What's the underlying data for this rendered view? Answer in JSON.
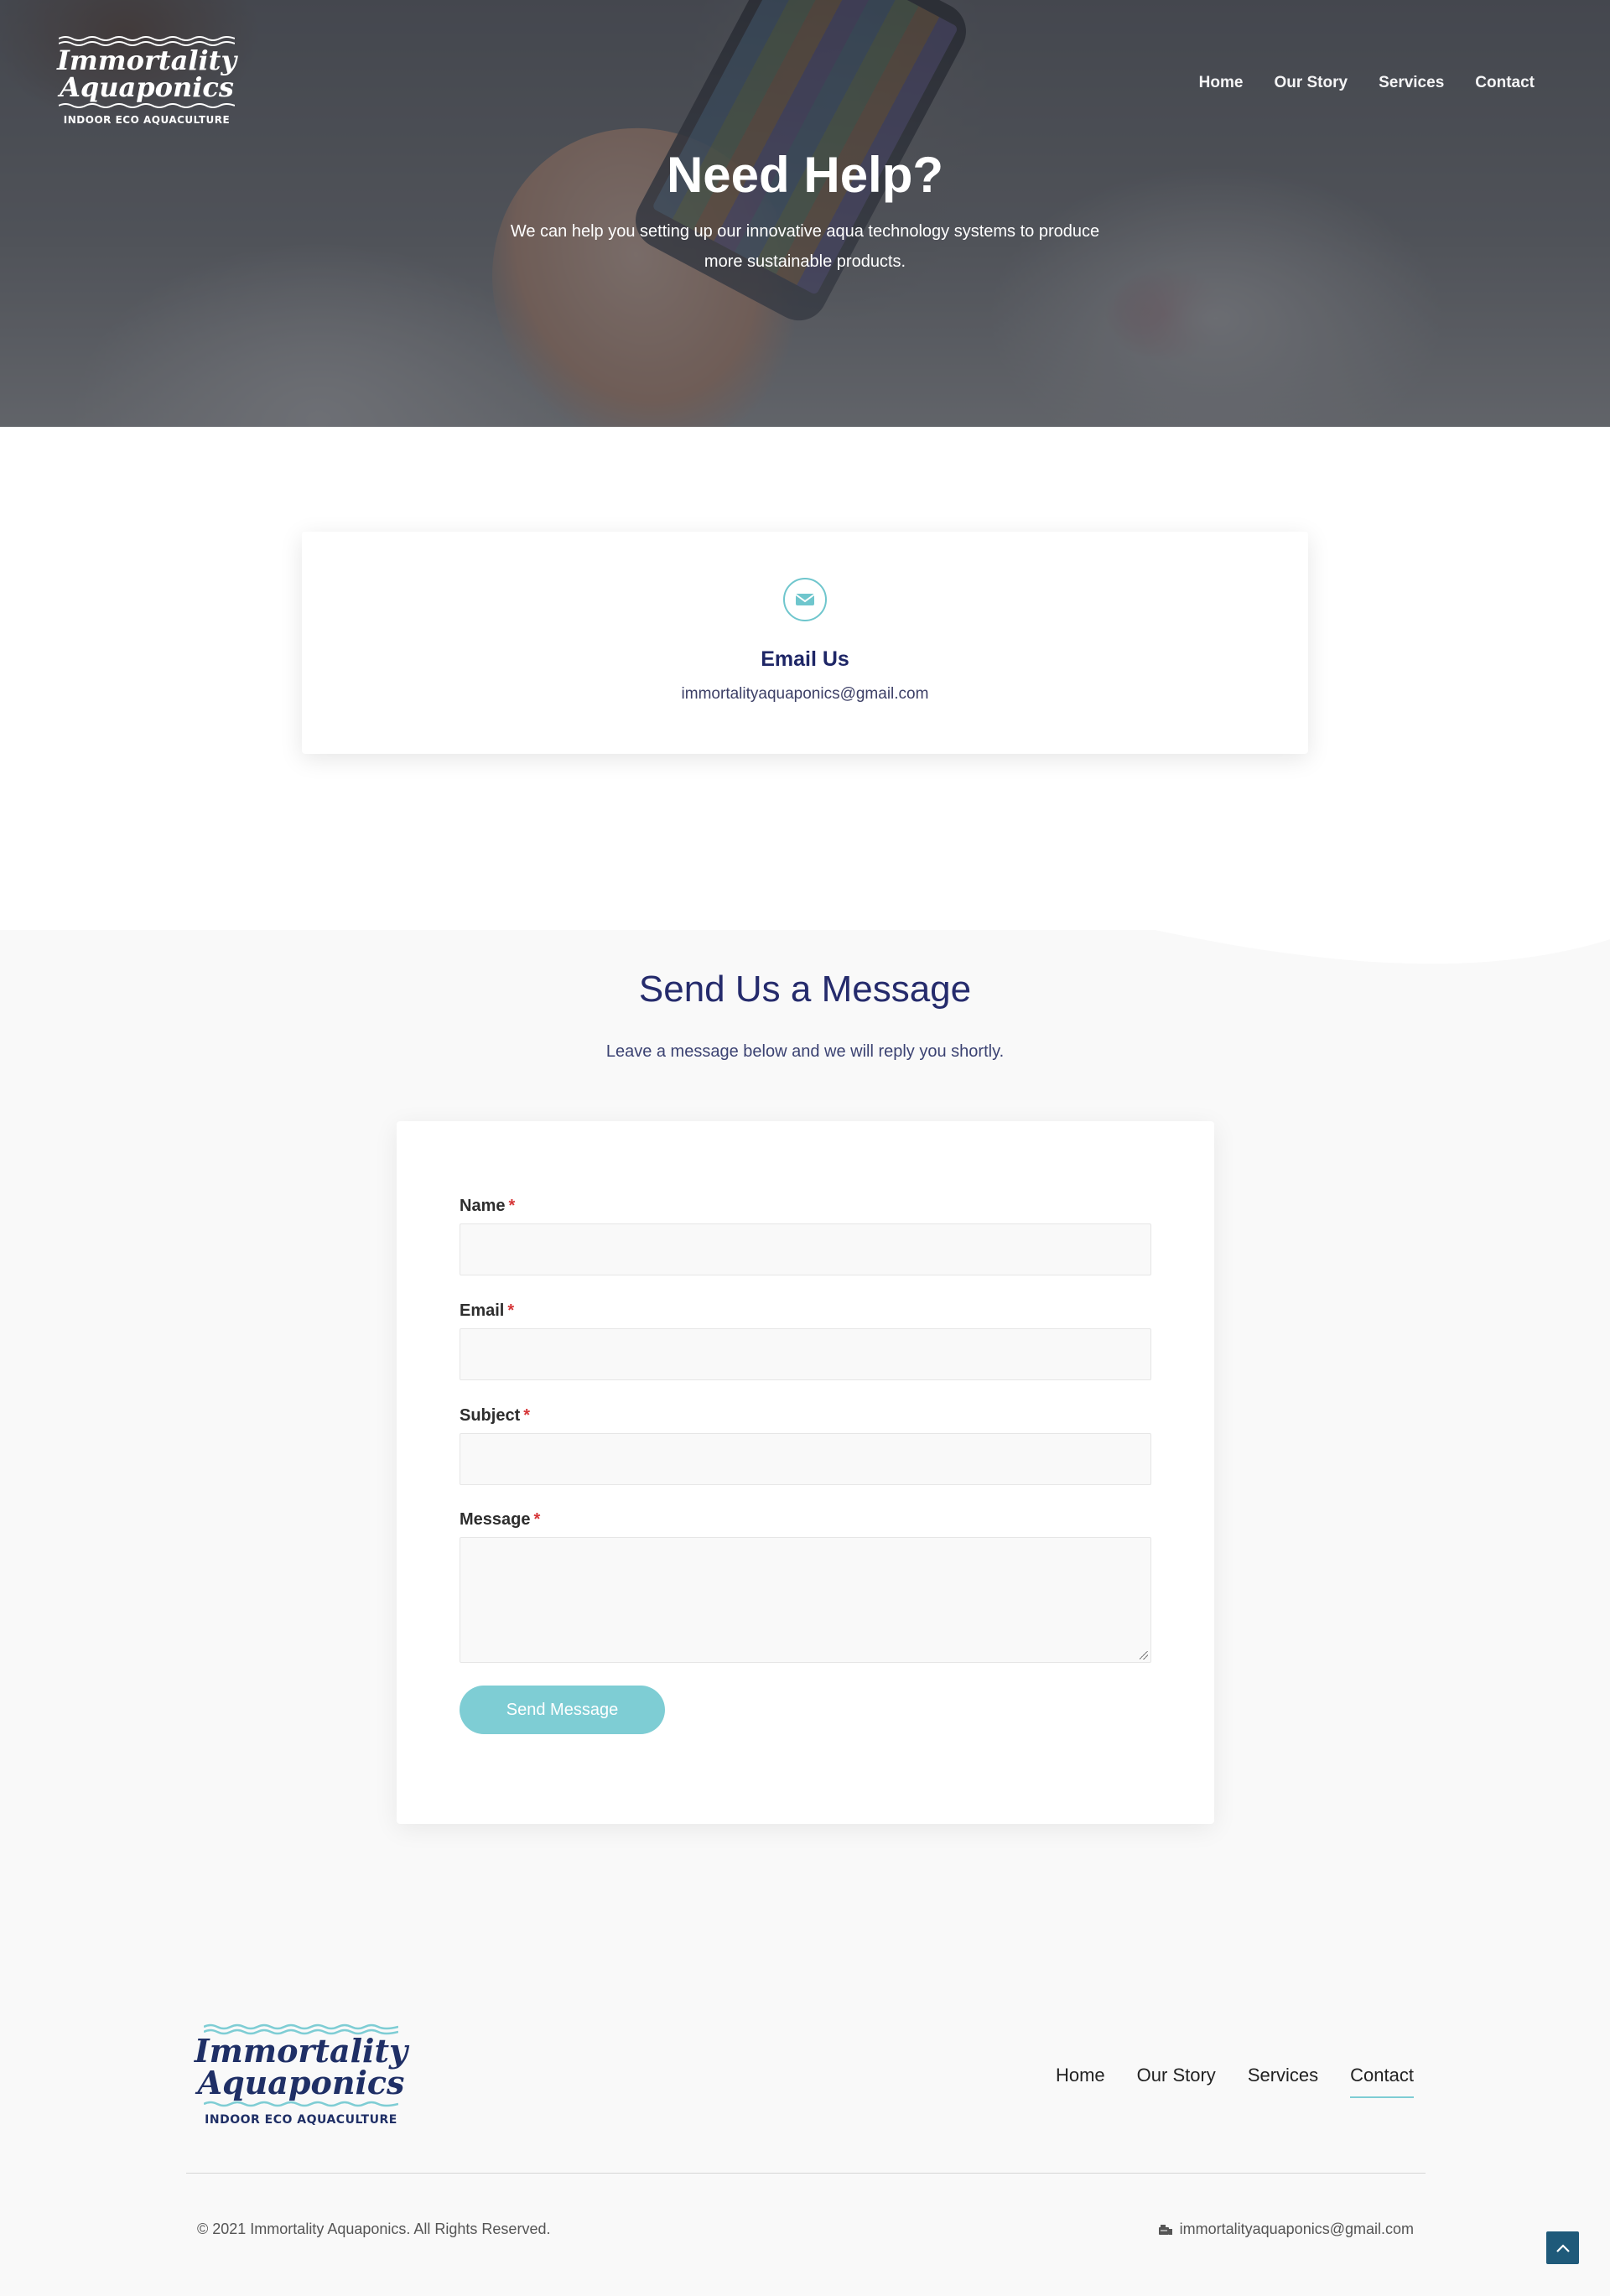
{
  "brand": {
    "logo_line1": "Immortality",
    "logo_line2": "Aquaponics",
    "tagline": "INDOOR ECO AQUACULTURE"
  },
  "nav": {
    "items": [
      {
        "label": "Home"
      },
      {
        "label": "Our Story"
      },
      {
        "label": "Services"
      },
      {
        "label": "Contact",
        "active": true
      }
    ]
  },
  "hero": {
    "title": "Need Help?",
    "subtitle": "We can help you setting up our innovative aqua technology systems to produce more sustainable products."
  },
  "contact_card": {
    "icon": "envelope-icon",
    "title": "Email Us",
    "email": "immortalityaquaponics@gmail.com"
  },
  "form_section": {
    "title": "Send Us a Message",
    "subtitle": "Leave a message below and we will reply you shortly.",
    "fields": [
      {
        "label": "Name",
        "required_mark": "*",
        "value": ""
      },
      {
        "label": "Email",
        "required_mark": "*",
        "value": ""
      },
      {
        "label": "Subject",
        "required_mark": "*",
        "value": ""
      },
      {
        "label": "Message",
        "required_mark": "*",
        "value": ""
      }
    ],
    "submit_label": "Send Message"
  },
  "footer": {
    "copyright": "© 2021 Immortality Aquaponics. All Rights Reserved.",
    "email": "immortalityaquaponics@gmail.com",
    "email_icon": "mail-box-icon",
    "scroll_top_icon": "chevron-up-icon"
  },
  "colors": {
    "accent": "#7ecdd4",
    "heading": "#252b6c",
    "required": "#d63638",
    "scroll_top_bg": "#1f5a7a"
  }
}
